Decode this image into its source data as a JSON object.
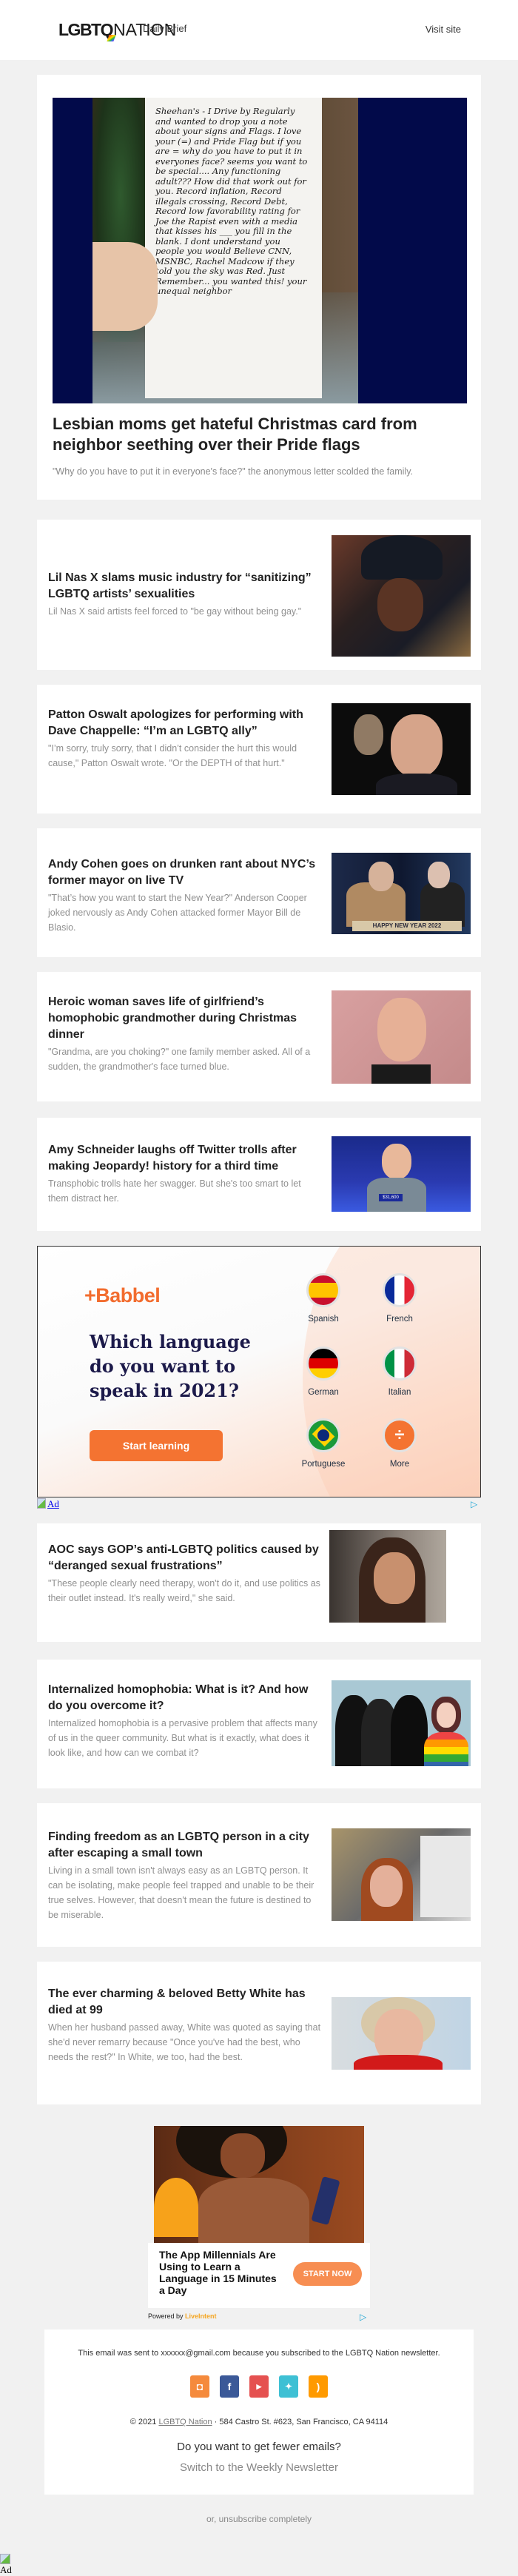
{
  "header": {
    "logo_bold": "LGBT",
    "logo_q": "Q",
    "logo_light": "NATION",
    "subtitle": "Daily Brief",
    "visit_link": "Visit site"
  },
  "hero": {
    "title": "Lesbian moms get hateful Christmas card from neighbor seething over their Pride flags",
    "subtitle": "\"Why do you have to put it in everyone's face?\" the anonymous letter scolded the family.",
    "note_text": "Sheehan's - I Drive by Regularly and wanted to drop you a note about your signs and Flags. I love your (=) and Pride Flag but if you are = why do you have to put it in everyones face? seems you want to be special.... Any functioning adult??? How did that work out for you. Record inflation, Record illegals crossing, Record Debt, Record low favorability rating for Joe the Rapist even with a media that kisses his ___ you fill in the blank. I dont understand you people you would Believe CNN, MSNBC, Rachel Madcow if they told you the sky was Red. Just Remember... you wanted this! your unequal neighbor"
  },
  "stories": [
    {
      "title": "Lil Nas X slams music industry for “sanitizing” LGBTQ artists’ sexualities",
      "subtitle": "Lil Nas X said artists feel forced to \"be gay without being gay.\""
    },
    {
      "title": "Patton Oswalt apologizes for performing with Dave Chappelle: “I’m an LGBTQ ally”",
      "subtitle": "\"I’m sorry, truly sorry, that I didn’t consider the hurt this would cause,\" Patton Oswalt wrote. \"Or the DEPTH of that hurt.\""
    },
    {
      "title": "Andy Cohen goes on drunken rant about NYC’s former mayor on live TV",
      "subtitle": "\"That’s how you want to start the New Year?\" Anderson Cooper joked nervously as Andy Cohen attacked former Mayor Bill de Blasio.",
      "image_caption": "HAPPY NEW YEAR 2022"
    },
    {
      "title": "Heroic woman saves life of girlfriend’s homophobic grandmother during Christmas dinner",
      "subtitle": "\"Grandma, are you choking?\" one family member asked. All of a sudden, the grandmother's face turned blue."
    },
    {
      "title": "Amy Schneider laughs off Twitter trolls after making Jeopardy! history for a third time",
      "subtitle": "Transphobic trolls hate her swagger. But she's too smart to let them distract her.",
      "image_caption": "$31,600"
    },
    {
      "title": "AOC says GOP’s anti-LGBTQ politics caused by “deranged sexual frustrations”",
      "subtitle": "\"These people clearly need therapy, won't do it, and use politics as their outlet instead. It's really weird,\" she said."
    },
    {
      "title": "Internalized homophobia: What is it? And how do you overcome it?",
      "subtitle": "Internalized homophobia is a pervasive problem that affects many of us in the queer community. But what is it exactly, what does it look like, and how can we combat it?"
    },
    {
      "title": "Finding freedom as an LGBTQ person in a city after escaping a small town",
      "subtitle": "Living in a small town isn't always easy as an LGBTQ person. It can be isolating, make people feel trapped and unable to be their true selves. However, that doesn't mean the future is destined to be miserable."
    },
    {
      "title": "The ever charming & beloved Betty White has died at 99",
      "subtitle": "When her husband passed away, White was quoted as saying that she'd never remarry because \"Once you've had the best, who needs the rest?\" In White, we too, had the best."
    }
  ],
  "babbel_ad": {
    "brand": "+Babbel",
    "headline": "Which language do you want to speak in 2021?",
    "cta": "Start learning",
    "languages": [
      "Spanish",
      "French",
      "German",
      "Italian",
      "Portuguese",
      "More"
    ],
    "accent_color": "#f47331",
    "ad_alt": "Ad"
  },
  "liveintent_ad": {
    "headline": "The App Millennials Are Using to Learn a Language in 15 Minutes a Day",
    "cta": "START NOW",
    "powered_by": "Powered by",
    "brand": "LiveIntent"
  },
  "footer": {
    "sent_to": "This email was sent to xxxxxx@gmail.com because you subscribed to the LGBTQ Nation newsletter.",
    "socials": [
      "instagram",
      "facebook",
      "youtube",
      "twitter",
      "rss"
    ],
    "copyright_prefix": "© 2021",
    "brand_link": "LGBTQ Nation",
    "address": "· 584 Castro St. #623, San Francisco, CA 94114",
    "fewer_emails": "Do you want to get fewer emails?",
    "switch_weekly": "Switch to the Weekly Newsletter",
    "unsubscribe": "or, unsubscribe completely"
  },
  "bottom_ad_alt": "Ad"
}
